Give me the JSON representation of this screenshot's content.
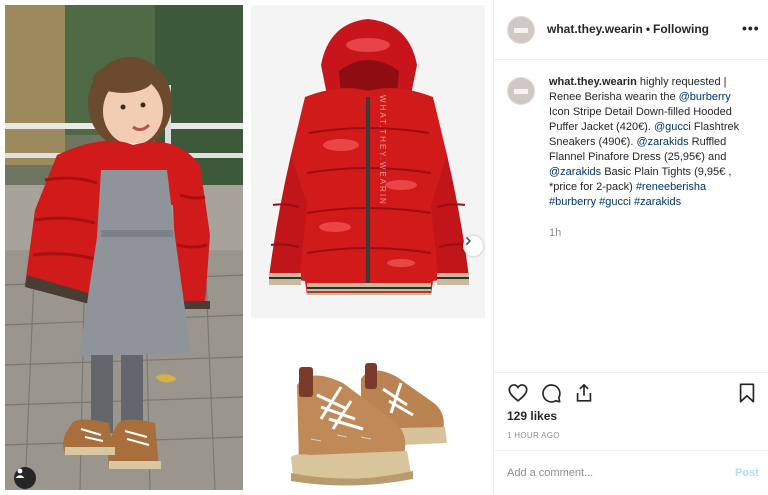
{
  "post": {
    "username": "what.they.wearin",
    "separator": "•",
    "follow_status": "Following",
    "more_label": "•••"
  },
  "caption": {
    "username": "what.they.wearin",
    "t1": " highly requested | Renee Berisha wearin the ",
    "m_burberry": "@burberry",
    "t2": " Icon Stripe Detail Down-filled Hooded Puffer Jacket (420€). ",
    "m_gucci": "@gucci",
    "t3": " Flashtrek Sneakers (490€). ",
    "m_zarakids1": "@zarakids",
    "t4": " Ruffled Flannel Pinafore Dress (25,95€) and ",
    "m_zarakids2": "@zarakids",
    "t5": " Basic Plain Tights (9,95€ , *price for 2-pack) ",
    "h1": "#reneeberisha",
    "h2": "#burberry",
    "h3": "#gucci",
    "h4": "#zarakids",
    "time": "1h"
  },
  "actions": {
    "likes": "129 likes",
    "post_age": "1 HOUR AGO",
    "icons": [
      "heart-icon",
      "comment-icon",
      "share-icon",
      "bookmark-icon"
    ]
  },
  "comment": {
    "placeholder": "Add a comment...",
    "post_label": "Post"
  },
  "media": {
    "icons": [
      "user-tag-icon",
      "chevron-right-icon"
    ],
    "jacket_print": "WHAT.THEY.WEARIN"
  },
  "colors": {
    "link": "#003569",
    "muted": "#8e8e8e",
    "post_disabled": "#b3dbff",
    "jacket_red": "#d11a1a"
  }
}
